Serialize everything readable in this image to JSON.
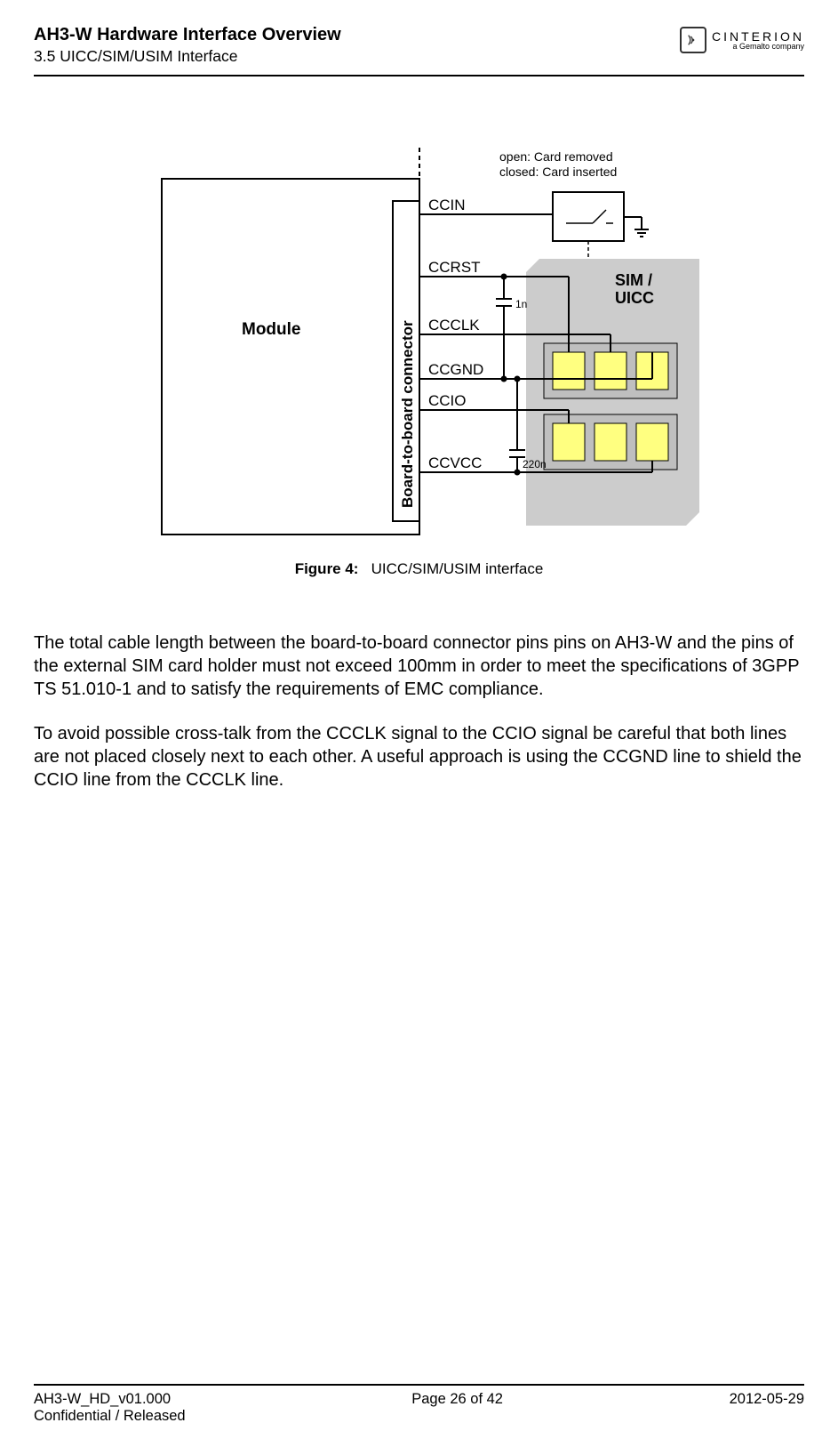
{
  "header": {
    "title": "AH3-W Hardware Interface Overview",
    "subtitle": "3.5 UICC/SIM/USIM Interface",
    "logo_text": "CINTERION",
    "logo_tagline": "a Gemalto company"
  },
  "diagram": {
    "module_label": "Module",
    "connector_label": "Board-to-board connector",
    "sim_label_line1": "SIM /",
    "sim_label_line2": "UICC",
    "note_line1": "open: Card removed",
    "note_line2": "closed: Card inserted",
    "cap1": "1n",
    "cap2": "220n",
    "signals": {
      "ccin": "CCIN",
      "ccrst": "CCRST",
      "ccclk": "CCCLK",
      "ccgnd": "CCGND",
      "ccio": "CCIO",
      "ccvcc": "CCVCC"
    }
  },
  "caption": {
    "label": "Figure 4:",
    "text": "UICC/SIM/USIM interface"
  },
  "paragraph1": "The total cable length between the board-to-board connector pins pins on AH3-W and the pins of the external SIM card holder must not exceed 100mm in order to meet the specifications of 3GPP TS 51.010-1 and to satisfy the requirements of EMC compliance.",
  "paragraph2": "To avoid possible cross-talk from the CCCLK signal to the CCIO signal be careful that both lines are not placed closely next to each other. A useful approach is using the CCGND line to shield the CCIO line from the CCCLK line.",
  "footer": {
    "left_line1": "AH3-W_HD_v01.000",
    "left_line2": "Confidential / Released",
    "center": "Page 26 of 42",
    "right": "2012-05-29"
  }
}
